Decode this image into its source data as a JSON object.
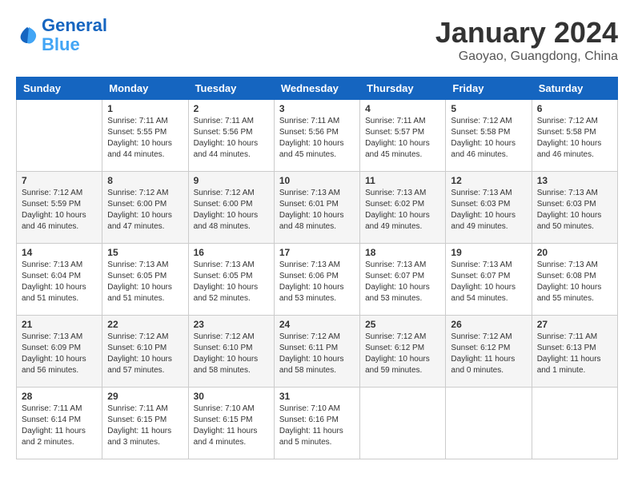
{
  "header": {
    "logo_general": "General",
    "logo_blue": "Blue",
    "title": "January 2024",
    "subtitle": "Gaoyao, Guangdong, China"
  },
  "days_of_week": [
    "Sunday",
    "Monday",
    "Tuesday",
    "Wednesday",
    "Thursday",
    "Friday",
    "Saturday"
  ],
  "weeks": [
    [
      {
        "day": "",
        "sunrise": "",
        "sunset": "",
        "daylight": ""
      },
      {
        "day": "1",
        "sunrise": "Sunrise: 7:11 AM",
        "sunset": "Sunset: 5:55 PM",
        "daylight": "Daylight: 10 hours and 44 minutes."
      },
      {
        "day": "2",
        "sunrise": "Sunrise: 7:11 AM",
        "sunset": "Sunset: 5:56 PM",
        "daylight": "Daylight: 10 hours and 44 minutes."
      },
      {
        "day": "3",
        "sunrise": "Sunrise: 7:11 AM",
        "sunset": "Sunset: 5:56 PM",
        "daylight": "Daylight: 10 hours and 45 minutes."
      },
      {
        "day": "4",
        "sunrise": "Sunrise: 7:11 AM",
        "sunset": "Sunset: 5:57 PM",
        "daylight": "Daylight: 10 hours and 45 minutes."
      },
      {
        "day": "5",
        "sunrise": "Sunrise: 7:12 AM",
        "sunset": "Sunset: 5:58 PM",
        "daylight": "Daylight: 10 hours and 46 minutes."
      },
      {
        "day": "6",
        "sunrise": "Sunrise: 7:12 AM",
        "sunset": "Sunset: 5:58 PM",
        "daylight": "Daylight: 10 hours and 46 minutes."
      }
    ],
    [
      {
        "day": "7",
        "sunrise": "Sunrise: 7:12 AM",
        "sunset": "Sunset: 5:59 PM",
        "daylight": "Daylight: 10 hours and 46 minutes."
      },
      {
        "day": "8",
        "sunrise": "Sunrise: 7:12 AM",
        "sunset": "Sunset: 6:00 PM",
        "daylight": "Daylight: 10 hours and 47 minutes."
      },
      {
        "day": "9",
        "sunrise": "Sunrise: 7:12 AM",
        "sunset": "Sunset: 6:00 PM",
        "daylight": "Daylight: 10 hours and 48 minutes."
      },
      {
        "day": "10",
        "sunrise": "Sunrise: 7:13 AM",
        "sunset": "Sunset: 6:01 PM",
        "daylight": "Daylight: 10 hours and 48 minutes."
      },
      {
        "day": "11",
        "sunrise": "Sunrise: 7:13 AM",
        "sunset": "Sunset: 6:02 PM",
        "daylight": "Daylight: 10 hours and 49 minutes."
      },
      {
        "day": "12",
        "sunrise": "Sunrise: 7:13 AM",
        "sunset": "Sunset: 6:03 PM",
        "daylight": "Daylight: 10 hours and 49 minutes."
      },
      {
        "day": "13",
        "sunrise": "Sunrise: 7:13 AM",
        "sunset": "Sunset: 6:03 PM",
        "daylight": "Daylight: 10 hours and 50 minutes."
      }
    ],
    [
      {
        "day": "14",
        "sunrise": "Sunrise: 7:13 AM",
        "sunset": "Sunset: 6:04 PM",
        "daylight": "Daylight: 10 hours and 51 minutes."
      },
      {
        "day": "15",
        "sunrise": "Sunrise: 7:13 AM",
        "sunset": "Sunset: 6:05 PM",
        "daylight": "Daylight: 10 hours and 51 minutes."
      },
      {
        "day": "16",
        "sunrise": "Sunrise: 7:13 AM",
        "sunset": "Sunset: 6:05 PM",
        "daylight": "Daylight: 10 hours and 52 minutes."
      },
      {
        "day": "17",
        "sunrise": "Sunrise: 7:13 AM",
        "sunset": "Sunset: 6:06 PM",
        "daylight": "Daylight: 10 hours and 53 minutes."
      },
      {
        "day": "18",
        "sunrise": "Sunrise: 7:13 AM",
        "sunset": "Sunset: 6:07 PM",
        "daylight": "Daylight: 10 hours and 53 minutes."
      },
      {
        "day": "19",
        "sunrise": "Sunrise: 7:13 AM",
        "sunset": "Sunset: 6:07 PM",
        "daylight": "Daylight: 10 hours and 54 minutes."
      },
      {
        "day": "20",
        "sunrise": "Sunrise: 7:13 AM",
        "sunset": "Sunset: 6:08 PM",
        "daylight": "Daylight: 10 hours and 55 minutes."
      }
    ],
    [
      {
        "day": "21",
        "sunrise": "Sunrise: 7:13 AM",
        "sunset": "Sunset: 6:09 PM",
        "daylight": "Daylight: 10 hours and 56 minutes."
      },
      {
        "day": "22",
        "sunrise": "Sunrise: 7:12 AM",
        "sunset": "Sunset: 6:10 PM",
        "daylight": "Daylight: 10 hours and 57 minutes."
      },
      {
        "day": "23",
        "sunrise": "Sunrise: 7:12 AM",
        "sunset": "Sunset: 6:10 PM",
        "daylight": "Daylight: 10 hours and 58 minutes."
      },
      {
        "day": "24",
        "sunrise": "Sunrise: 7:12 AM",
        "sunset": "Sunset: 6:11 PM",
        "daylight": "Daylight: 10 hours and 58 minutes."
      },
      {
        "day": "25",
        "sunrise": "Sunrise: 7:12 AM",
        "sunset": "Sunset: 6:12 PM",
        "daylight": "Daylight: 10 hours and 59 minutes."
      },
      {
        "day": "26",
        "sunrise": "Sunrise: 7:12 AM",
        "sunset": "Sunset: 6:12 PM",
        "daylight": "Daylight: 11 hours and 0 minutes."
      },
      {
        "day": "27",
        "sunrise": "Sunrise: 7:11 AM",
        "sunset": "Sunset: 6:13 PM",
        "daylight": "Daylight: 11 hours and 1 minute."
      }
    ],
    [
      {
        "day": "28",
        "sunrise": "Sunrise: 7:11 AM",
        "sunset": "Sunset: 6:14 PM",
        "daylight": "Daylight: 11 hours and 2 minutes."
      },
      {
        "day": "29",
        "sunrise": "Sunrise: 7:11 AM",
        "sunset": "Sunset: 6:15 PM",
        "daylight": "Daylight: 11 hours and 3 minutes."
      },
      {
        "day": "30",
        "sunrise": "Sunrise: 7:10 AM",
        "sunset": "Sunset: 6:15 PM",
        "daylight": "Daylight: 11 hours and 4 minutes."
      },
      {
        "day": "31",
        "sunrise": "Sunrise: 7:10 AM",
        "sunset": "Sunset: 6:16 PM",
        "daylight": "Daylight: 11 hours and 5 minutes."
      },
      {
        "day": "",
        "sunrise": "",
        "sunset": "",
        "daylight": ""
      },
      {
        "day": "",
        "sunrise": "",
        "sunset": "",
        "daylight": ""
      },
      {
        "day": "",
        "sunrise": "",
        "sunset": "",
        "daylight": ""
      }
    ]
  ]
}
